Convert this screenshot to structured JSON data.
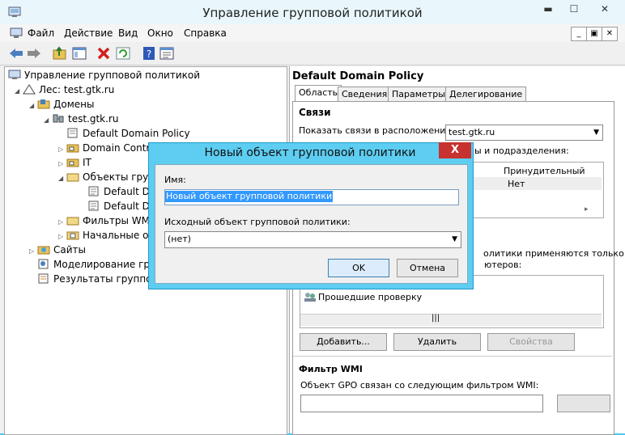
{
  "window": {
    "title": "Управление групповой политикой"
  },
  "menu": [
    "Файл",
    "Действие",
    "Вид",
    "Окно",
    "Справка"
  ],
  "tree": {
    "root": "Управление групповой политикой",
    "forest": "Лес: test.gtk.ru",
    "domains": "Домены",
    "domain": "test.gtk.ru",
    "default_policy": "Default Domain Policy",
    "domain_controllers": "Domain Contr",
    "it": "IT",
    "gpo_objects": "Объекты груп",
    "gpo_default_1": "Default Do",
    "gpo_default_2": "Default Do",
    "wmi_filters": "Фильтры WMI",
    "starter": "Начальные о",
    "sites": "Сайты",
    "modeling": "Моделирование груп",
    "results": "Результаты группов"
  },
  "right": {
    "title": "Default Domain Policy",
    "tabs": [
      "Область",
      "Сведения",
      "Параметры",
      "Делегирование"
    ],
    "links_heading": "Связи",
    "show_links_label": "Показать связи в расположении:",
    "location_value": "test.gtk.ru",
    "sites_text_fragment": "ы и подразделения:",
    "col_enforced": "Принудительный",
    "enforced_value": "Нет",
    "security_text_1": "олитики применяются только дл",
    "security_text_2": "ютеров:",
    "authenticated": "Прошедшие проверку",
    "add_btn": "Добавить...",
    "remove_btn": "Удалить",
    "props_btn": "Свойства",
    "wmi_heading": "Фильтр WMI",
    "wmi_text": "Объект GPO связан со следующим фильтром WMI:"
  },
  "dialog": {
    "title": "Новый объект групповой политики",
    "close": "X",
    "name_label": "Имя:",
    "name_value": "Новый объект групповой политики",
    "source_label": "Исходный объект групповой политики:",
    "source_value": "(нет)",
    "ok": "OK",
    "cancel": "Отмена"
  }
}
